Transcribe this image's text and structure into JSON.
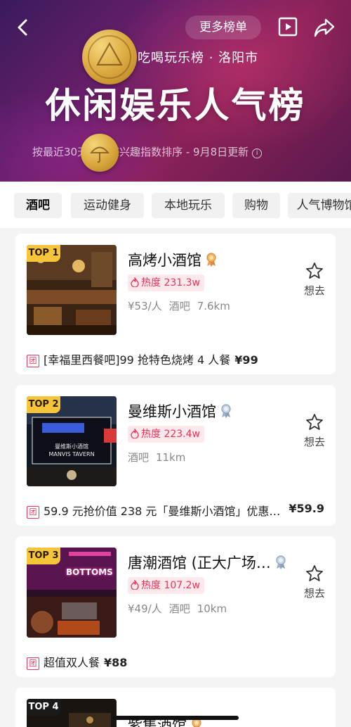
{
  "header": {
    "more_lists": "更多榜单",
    "subtitle": "吃喝玩乐榜 · 洛阳市",
    "title": "休闲娱乐人气榜",
    "rank_note": "按最近30天用户感兴趣指数排序 - 9月8日更新",
    "info_icon_char": "i",
    "colors": {
      "bg_start": "#3a1a5c",
      "bg_mid": "#8a2158"
    }
  },
  "tabs": [
    {
      "label": "酒吧",
      "active": true
    },
    {
      "label": "运动健身",
      "active": false
    },
    {
      "label": "本地玩乐",
      "active": false
    },
    {
      "label": "购物",
      "active": false
    },
    {
      "label": "人气博物馆",
      "active": false
    }
  ],
  "cards": [
    {
      "rank": "TOP 1",
      "name": "高烤小酒馆",
      "medal": "gold",
      "heat": "热度 231.3w",
      "price": "¥53/人",
      "category": "酒吧",
      "distance": "7.6km",
      "want": "想去",
      "deal_tag": "团",
      "deal": "[幸福里西餐吧]99 抢特色烧烤 4 人餐",
      "deal_price": "¥99"
    },
    {
      "rank": "TOP 2",
      "name": "曼维斯小酒馆",
      "medal": "silver",
      "heat": "热度 223.4w",
      "price": "",
      "category": "酒吧",
      "distance": "11km",
      "want": "想去",
      "deal_tag": "团",
      "deal": "59.9 元抢价值 238 元「曼维斯小酒馆」优惠…",
      "deal_price": "¥59.9",
      "sign_text_1": "曼维斯小酒馆",
      "sign_text_2": "MANVIS TAVERN"
    },
    {
      "rank": "TOP 3",
      "name": "唐潮酒馆 (正大广场…",
      "medal": "silver",
      "heat": "热度 107.2w",
      "price": "¥49/人",
      "category": "酒吧",
      "distance": "10km",
      "want": "想去",
      "deal_tag": "团",
      "deal": "超值双人餐",
      "deal_price": "¥88",
      "sign_text_1": "BOTTOMS"
    },
    {
      "rank": "TOP 4",
      "name": "紫集酒馆",
      "medal": "gold"
    }
  ],
  "accent_colors": {
    "heat": "#e8355a",
    "badge": "#f6c53a"
  }
}
